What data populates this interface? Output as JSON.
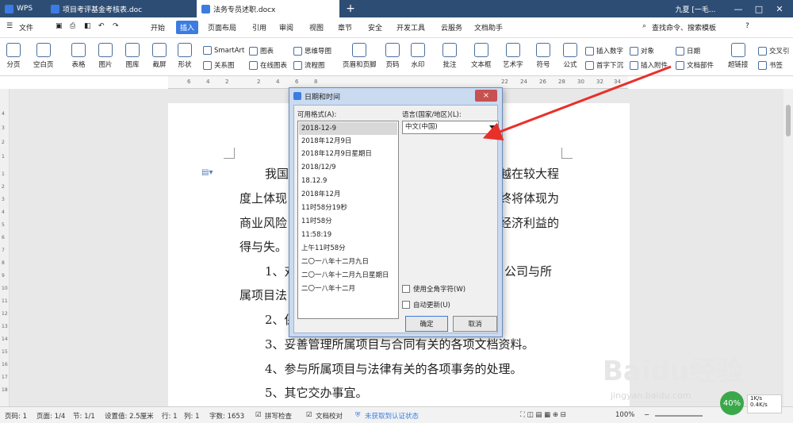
{
  "titlebar": {
    "tabs": [
      {
        "label": "WPS"
      },
      {
        "label": "项目考评基金考核表.doc"
      },
      {
        "label": "法务专员述职.docx"
      }
    ],
    "add_tab": "+",
    "user": "九夏 [一毛..."
  },
  "menubar": {
    "file": "文件",
    "items": [
      "开始",
      "插入",
      "页面布局",
      "引用",
      "审阅",
      "视图",
      "章节",
      "安全",
      "开发工具",
      "云服务",
      "文档助手"
    ],
    "active": "插入",
    "search": "查找命令、搜索模板",
    "help": "?"
  },
  "ribbon": {
    "buttons": [
      {
        "label": "分页"
      },
      {
        "label": "空白页"
      },
      {
        "label": "表格"
      },
      {
        "label": "图片"
      },
      {
        "label": "图库"
      },
      {
        "label": "截屏"
      },
      {
        "label": "形状"
      },
      {
        "label": "页眉和页脚"
      },
      {
        "label": "页码"
      },
      {
        "label": "水印"
      },
      {
        "label": "批注"
      },
      {
        "label": "文本框"
      },
      {
        "label": "艺术字"
      },
      {
        "label": "符号"
      },
      {
        "label": "公式"
      },
      {
        "label": "超链接"
      },
      {
        "label": "书签"
      }
    ],
    "small": [
      "SmartArt",
      "关系图",
      "图表",
      "在线图表",
      "思维导图",
      "流程图",
      "插入数字",
      "首字下沉",
      "对象",
      "插入附件",
      "日期",
      "文档部件",
      "交叉引"
    ]
  },
  "ruler": {
    "ticks": [
      "6",
      "4",
      "2",
      "2",
      "4",
      "6",
      "8",
      "10",
      "12",
      "14",
      "16",
      "18",
      "20",
      "22",
      "24",
      "26",
      "28",
      "30",
      "32",
      "34",
      "36",
      "38"
    ]
  },
  "vruler": {
    "ticks": [
      "4",
      "3",
      "2",
      "1",
      "1",
      "2",
      "3",
      "4",
      "5",
      "6",
      "7",
      "8",
      "9",
      "10",
      "11",
      "12",
      "13",
      "14",
      "15",
      "16",
      "17",
      "18",
      "19",
      "20"
    ]
  },
  "document": {
    "lines": [
      "我国",
      "越在较大程",
      "度上体现",
      "终将体现为",
      "商业风险",
      "经济利益的",
      "得与失。",
      "1、对",
      "公司与所",
      "属项目法",
      "2、保",
      "3、妥善管理所属项目与合同有关的各项文档资料。",
      "4、参与所属项目与法律有关的各项事务的处理。",
      "5、其它交办事宜。"
    ]
  },
  "dialog": {
    "title": "日期和时间",
    "close": "×",
    "formats_label": "可用格式(A):",
    "formats": [
      "2018-12-9",
      "2018年12月9日",
      "2018年12月9日星期日",
      "2018/12/9",
      "18.12.9",
      "2018年12月",
      "11时58分19秒",
      "11时58分",
      "11:58:19",
      "上午11时58分",
      "二〇一八年十二月九日",
      "二〇一八年十二月九日星期日",
      "二〇一八年十二月"
    ],
    "selected_format": "2018-12-9",
    "language_label": "语言(国家/地区)(L):",
    "language_value": "中文(中国)",
    "fullwidth_label": "使用全角字符(W)",
    "autoupdate_label": "自动更新(U)",
    "ok": "确定",
    "cancel": "取消"
  },
  "statusbar": {
    "page": "页码: 1",
    "pages": "页面: 1/4",
    "section": "节: 1/1",
    "setting": "设置值: 2.5厘米",
    "row": "行: 1",
    "col": "列: 1",
    "words": "字数: 1653",
    "spell": "拼写检查",
    "proof": "文档校对",
    "cert": "未获取到认证状态",
    "zoom": "100%",
    "net_percent": "40%",
    "up": "1K/s",
    "down": "0.4K/s"
  },
  "watermark": {
    "brand": "Baidu经验",
    "url": "jingyan.baidu.com"
  },
  "colors": {
    "titlebar": "#2e4d74",
    "accent": "#3b7ce0",
    "arrow": "#e8302a",
    "dialog_frame": "#c9daf1"
  }
}
